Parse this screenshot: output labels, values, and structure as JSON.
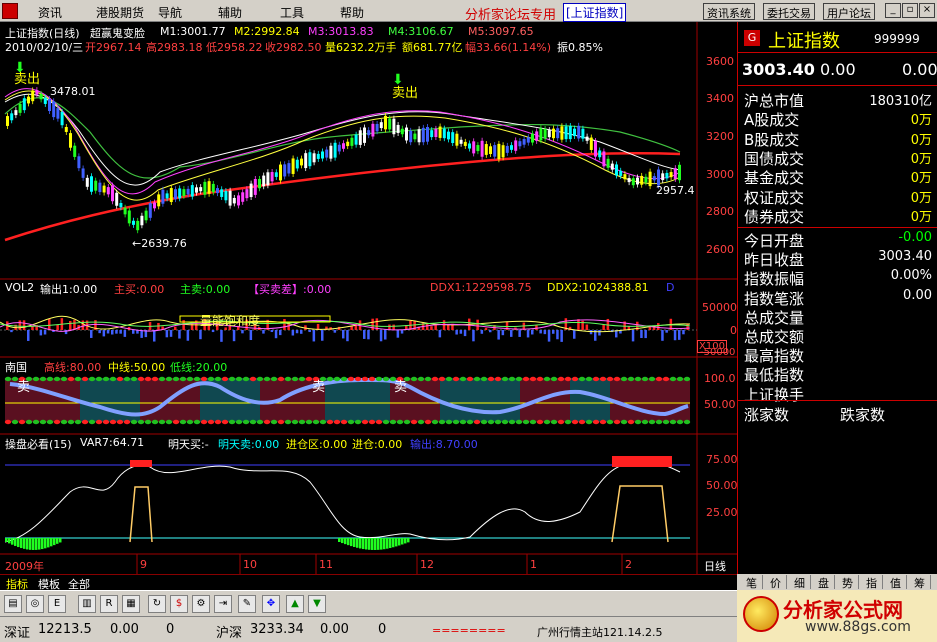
{
  "menu": {
    "items": [
      "资讯",
      "港股期货",
      "导航",
      "辅助",
      "工具",
      "帮助"
    ],
    "title": "分析家论坛专用",
    "title_box": "[上证指数]",
    "buttons": [
      "资讯系统",
      "委托交易",
      "用户论坛"
    ]
  },
  "main_chart": {
    "name": "上证指数(日线)",
    "formula": "超赢鬼变脸",
    "m1": "M1:3001.77",
    "m2": "M2:2992.84",
    "m3": "M3:3013.83",
    "m4": "M4:3106.67",
    "m5": "M5:3097.65",
    "date": "2010/02/10/三",
    "open": "开2967.14",
    "high": "高2983.18",
    "low": "低2958.22",
    "close": "收2982.50",
    "volume": "量6232.2万手",
    "amount": "额681.77亿",
    "range": "幅33.66(1.14%)",
    "amplitude": "振0.85%",
    "sell_label_1": "卖出",
    "sell_label_2": "卖出",
    "high_mark": "3478.01",
    "low_mark": "←2639.76",
    "last_mark": "2957.4",
    "y_ticks": [
      "3600",
      "3400",
      "3200",
      "3000",
      "2800",
      "2600"
    ]
  },
  "vol_panel": {
    "name": "VOL2",
    "output": "输出1:0.00",
    "main_sell": "主买:0.00",
    "main_buy": "主卖:0.00",
    "buy_sell_diff": "【买卖差】:0.00",
    "ddx1": "DDX1:1229598.75",
    "ddx2": "DDX2:1024388.81",
    "d": "D",
    "note": "量能饱和度",
    "y_ticks": [
      "50000",
      "0",
      "-50000"
    ],
    "unit": "X100"
  },
  "south_panel": {
    "name": "南国",
    "high": "高线:80.00",
    "mid": "中线:50.00",
    "low": "低线:20.00",
    "sell_a": "卖",
    "sell_b": "卖",
    "sell_c": "卖",
    "y_ticks": [
      "100.0",
      "50.00"
    ]
  },
  "op_panel": {
    "name": "操盘必看(15)",
    "var7": "VAR7:64.71",
    "tomorrow_buy": "明天买:-",
    "tomorrow_sell": "明天卖:0.00",
    "enter_zone": "进仓区:0.00",
    "enter": "进仓:0.00",
    "output": "输出:8.70.00",
    "y_ticks": [
      "75.00",
      "50.00",
      "25.00"
    ]
  },
  "x_axis": {
    "labels": [
      "2009年",
      "9",
      "10",
      "11",
      "12",
      "1",
      "2"
    ],
    "period": "日线"
  },
  "bottom_tabs": [
    "指标",
    "模板",
    "全部"
  ],
  "right_panel": {
    "badge": "G",
    "index_name": "上证指数",
    "code": "999999",
    "price": "3003.40",
    "change": "0.00",
    "change2": "0.00",
    "rows": [
      {
        "label": "沪总市值",
        "value": "180310亿",
        "color": "#ffffff"
      },
      {
        "label": "A股成交",
        "value": "0万",
        "color": "#ffff00"
      },
      {
        "label": "B股成交",
        "value": "0万",
        "color": "#ffff00"
      },
      {
        "label": "国债成交",
        "value": "0万",
        "color": "#ffff00"
      },
      {
        "label": "基金成交",
        "value": "0万",
        "color": "#ffff00"
      },
      {
        "label": "权证成交",
        "value": "0万",
        "color": "#ffff00"
      },
      {
        "label": "债券成交",
        "value": "0万",
        "color": "#ffff00"
      }
    ],
    "rows2": [
      {
        "label": "今日开盘",
        "value": "-0.00",
        "color": "#00ff00"
      },
      {
        "label": "昨日收盘",
        "value": "3003.40",
        "color": "#ffffff"
      },
      {
        "label": "指数振幅",
        "value": "0.00%",
        "color": "#ffffff"
      },
      {
        "label": "指数笔涨",
        "value": "0.00",
        "color": "#ffffff"
      },
      {
        "label": "总成交量",
        "value": "",
        "color": "#ffffff"
      },
      {
        "label": "总成交额",
        "value": "",
        "color": "#ffffff"
      },
      {
        "label": "最高指数",
        "value": "",
        "color": "#ffffff"
      },
      {
        "label": "最低指数",
        "value": "",
        "color": "#ffffff"
      },
      {
        "label": "上证换手",
        "value": "",
        "color": "#ffffff"
      }
    ],
    "up_count": "涨家数",
    "down_count": "跌家数",
    "tabs": [
      "笔",
      "价",
      "细",
      "盘",
      "势",
      "指",
      "值",
      "筹"
    ]
  },
  "status": {
    "sz_label": "深证",
    "sz_value": "12213.5",
    "sz_change": "0.00",
    "sz_vol": "0",
    "hs_label": "沪深",
    "hs_value": "3233.34",
    "hs_change": "0.00",
    "hs_vol": "0",
    "server": "广州行情主站121.14.2.5",
    "dashes": "========"
  },
  "promo": {
    "brand": "分析家公式网",
    "url": "www.88gs.com"
  },
  "colors": {
    "up": "#ff3030",
    "down": "#00ffff",
    "accent": "#ffff00"
  }
}
